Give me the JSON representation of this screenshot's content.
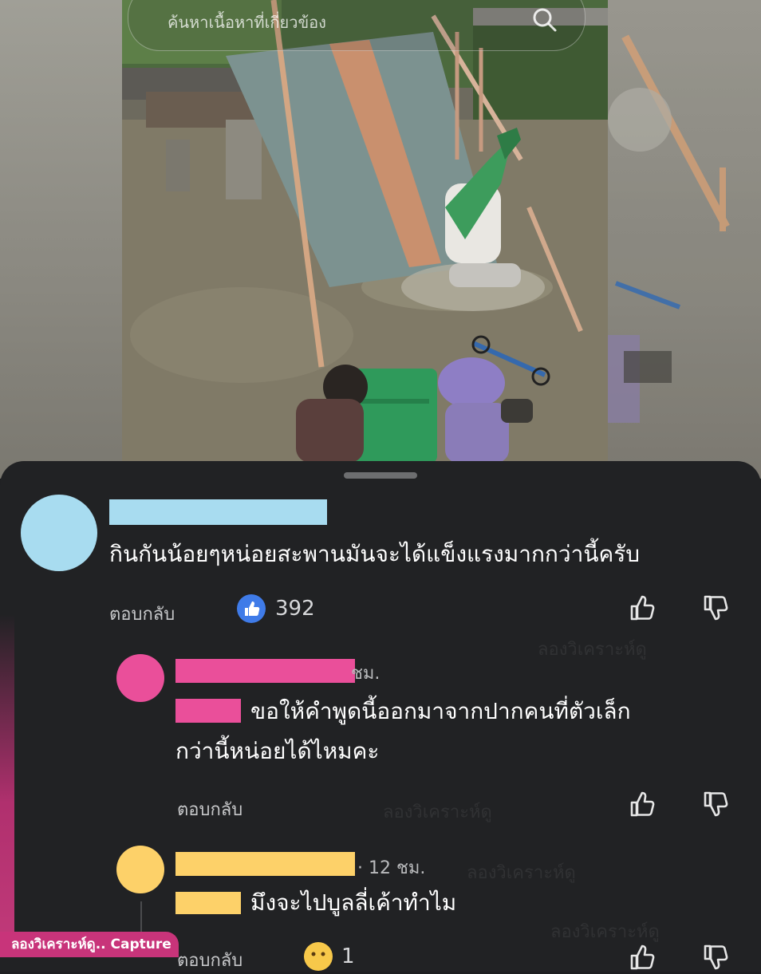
{
  "search": {
    "placeholder": "ค้นหาเนื้อหาที่เกี่ยวข้อง"
  },
  "comments": [
    {
      "avatar_color": "#a8dcf0",
      "name_bar_color": "#a8dcf0",
      "text": "กินกันน้อยๆหน่อยสะพานมันจะได้แข็งแรงมากกว่านี้ครับ",
      "reply_label": "ตอบกลับ",
      "like_count": "392"
    },
    {
      "avatar_color": "#ea4f9a",
      "name_bar_color": "#ea4f9a",
      "time": "ชม.",
      "mention_color": "#ea4f9a",
      "text_line1": "ขอให้คำพูดนี้ออกมาจากปากคนที่ตัวเล็ก",
      "text_line2": "กว่านี้หน่อยได้ไหมคะ",
      "reply_label": "ตอบกลับ"
    },
    {
      "avatar_color": "#fdd169",
      "name_bar_color": "#fdd169",
      "time": "· 12 ชม.",
      "mention_color": "#fdd169",
      "text": "มึงจะไปบูลลี่เค้าทำไม",
      "reply_label": "ตอบกลับ",
      "like_count": "1"
    }
  ],
  "watermark": "ลองวิเคราะห์ดู",
  "capture_tag": "ลองวิเคราะห์ดู.. Capture",
  "colors": {
    "like_blue": "#3f7be8",
    "sheet_bg": "#212224"
  }
}
